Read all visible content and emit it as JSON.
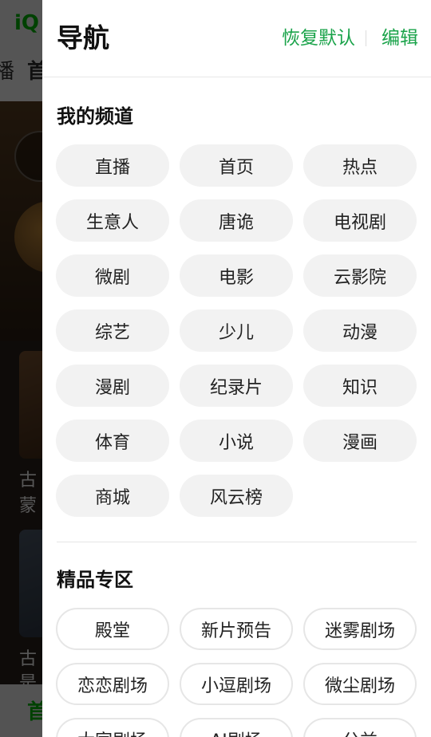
{
  "background": {
    "logo": "iQ",
    "tab_partial_left": "播",
    "tab_partial_home": "首",
    "card_texts": [
      "古",
      "蒙",
      "古",
      "是"
    ],
    "bottom_home": "首"
  },
  "drawer": {
    "title": "导航",
    "reset_label": "恢复默认",
    "edit_label": "编辑",
    "my_channels": {
      "title": "我的频道",
      "items": [
        "直播",
        "首页",
        "热点",
        "生意人",
        "唐诡",
        "电视剧",
        "微剧",
        "电影",
        "云影院",
        "综艺",
        "少儿",
        "动漫",
        "漫剧",
        "纪录片",
        "知识",
        "体育",
        "小说",
        "漫画",
        "商城",
        "风云榜"
      ]
    },
    "premium_zone": {
      "title": "精品专区",
      "items": [
        "殿堂",
        "新片预告",
        "迷雾剧场",
        "恋恋剧场",
        "小逗剧场",
        "微尘剧场",
        "大家剧场",
        "AI剧场",
        "公益"
      ]
    }
  },
  "colors": {
    "accent": "#1aa34a",
    "brand": "#00be06",
    "chip_bg": "#f2f2f2"
  }
}
